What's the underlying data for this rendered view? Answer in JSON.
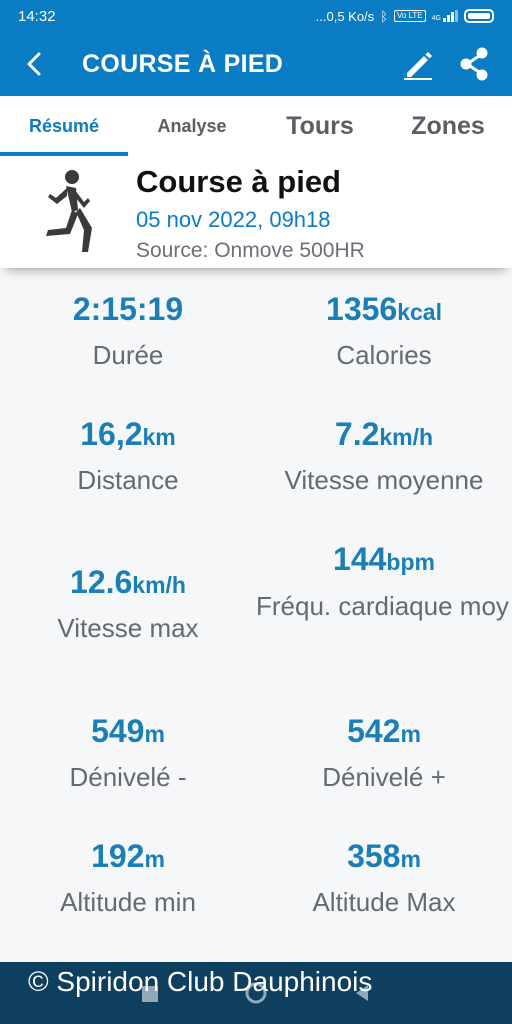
{
  "status_bar": {
    "time": "14:32",
    "network_speed": "...0,5 Ko/s",
    "volte": "Vo LTE",
    "lte": "4G"
  },
  "app_bar": {
    "title": "COURSE À PIED",
    "back_icon": "chevron-left-icon",
    "edit_icon": "pencil-icon",
    "share_icon": "share-icon"
  },
  "tabs": [
    {
      "label": "Résumé",
      "active": true
    },
    {
      "label": "Analyse",
      "active": false
    },
    {
      "label": "Tours",
      "active": false
    },
    {
      "label": "Zones",
      "active": false
    }
  ],
  "activity": {
    "icon": "runner-icon",
    "title": "Course à pied",
    "date": "05 nov 2022, 09h18",
    "source": "Source: Onmove 500HR"
  },
  "stats": [
    {
      "value": "2:15:19",
      "unit": "",
      "label": "Durée"
    },
    {
      "value": "1356",
      "unit": "kcal",
      "label": "Calories"
    },
    {
      "value": "16,2",
      "unit": "km",
      "label": "Distance"
    },
    {
      "value": "7.2",
      "unit": "km/h",
      "label": "Vitesse moyenne"
    },
    {
      "value": "12.6",
      "unit": "km/h",
      "label": "Vitesse max"
    },
    {
      "value": "144",
      "unit": "bpm",
      "label": "Fréqu. cardiaque moy"
    },
    {
      "value": "549",
      "unit": "m",
      "label": "Dénivelé -"
    },
    {
      "value": "542",
      "unit": "m",
      "label": "Dénivelé +"
    },
    {
      "value": "192",
      "unit": "m",
      "label": "Altitude min"
    },
    {
      "value": "358",
      "unit": "m",
      "label": "Altitude Max"
    }
  ],
  "footer": {
    "watermark": "© Spiridon Club Dauphinois"
  },
  "colors": {
    "primary": "#0a7cc3",
    "value_text": "#1b7fb6",
    "label_text": "#646a72",
    "footer_bg": "#0f3f5f"
  }
}
